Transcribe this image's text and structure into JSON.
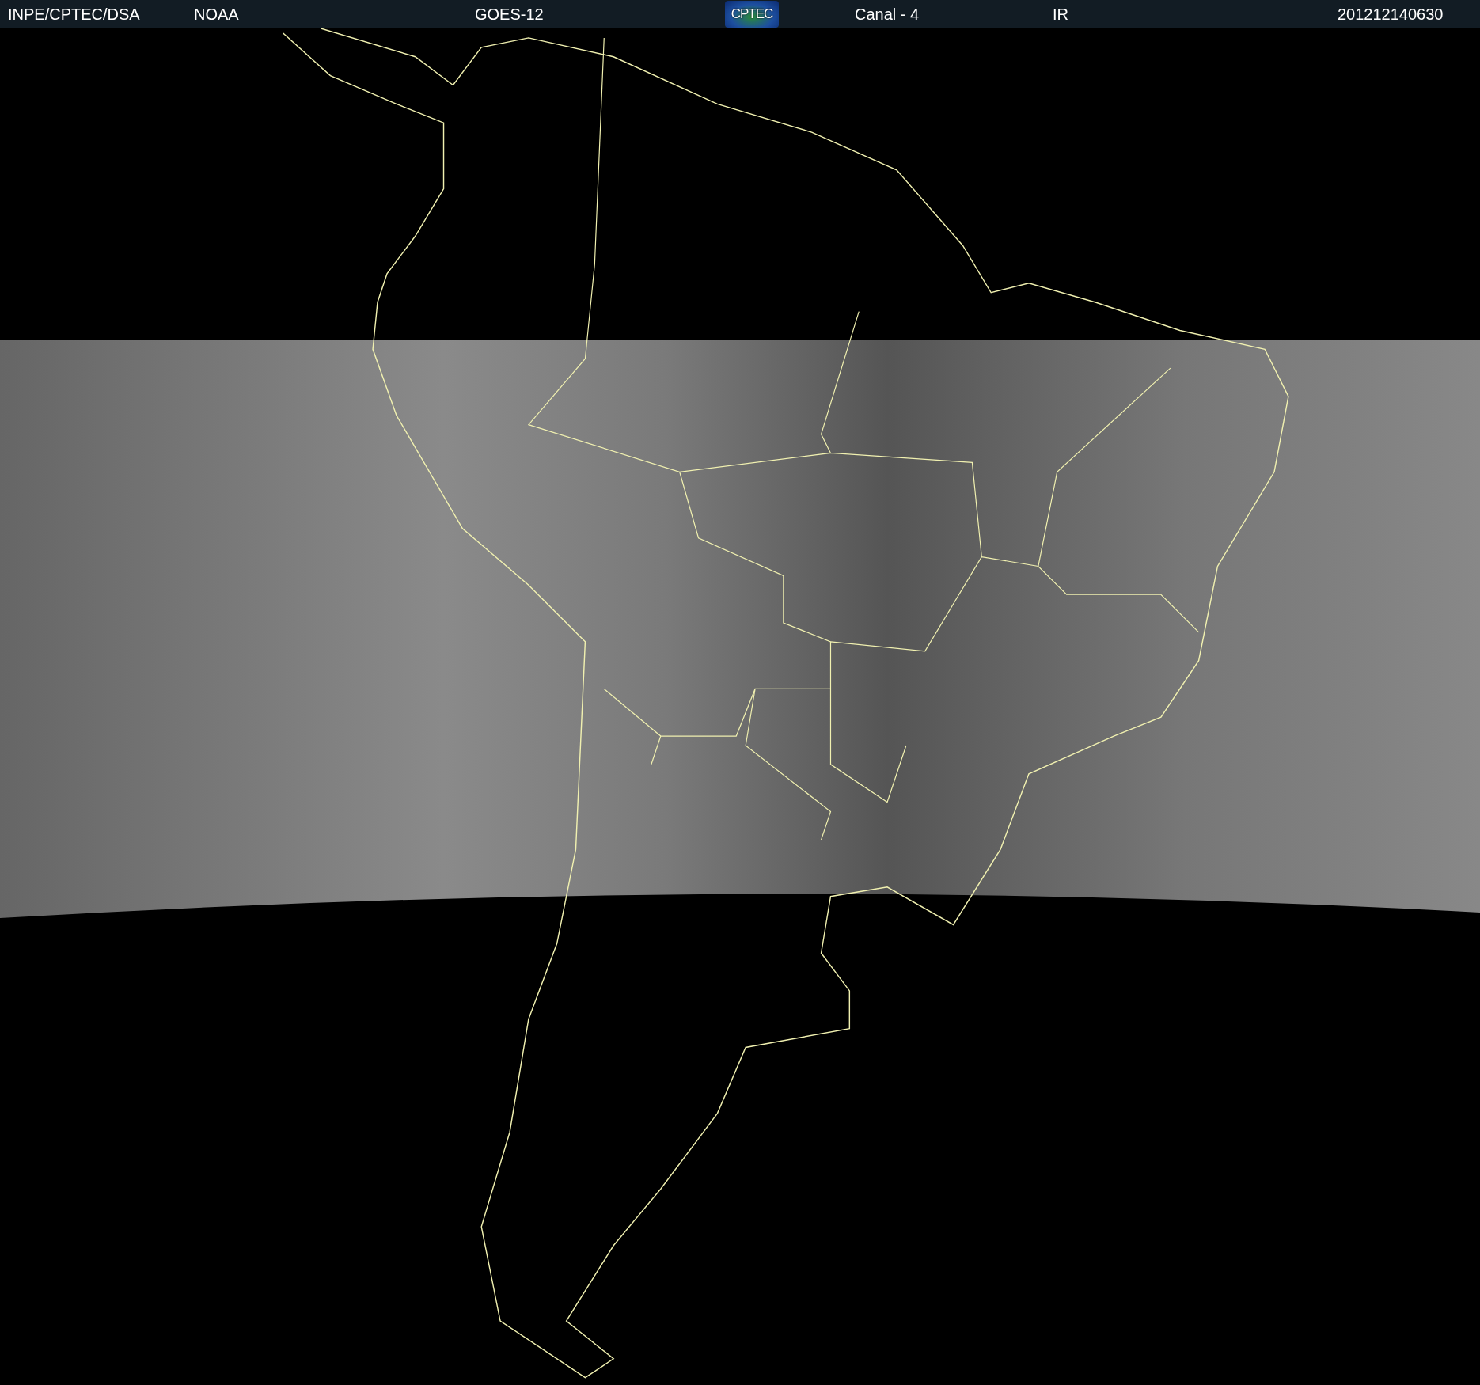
{
  "header": {
    "items": [
      {
        "kind": "text",
        "text": "INPE/CPTEC/DSA"
      },
      {
        "kind": "text",
        "text": "NOAA"
      },
      {
        "kind": "text",
        "text": "GOES-12"
      },
      {
        "kind": "logo",
        "text": "CPTEC"
      },
      {
        "kind": "text",
        "text": "Canal - 4"
      },
      {
        "kind": "text",
        "text": "IR"
      },
      {
        "kind": "text",
        "text": "201212140630"
      }
    ]
  }
}
